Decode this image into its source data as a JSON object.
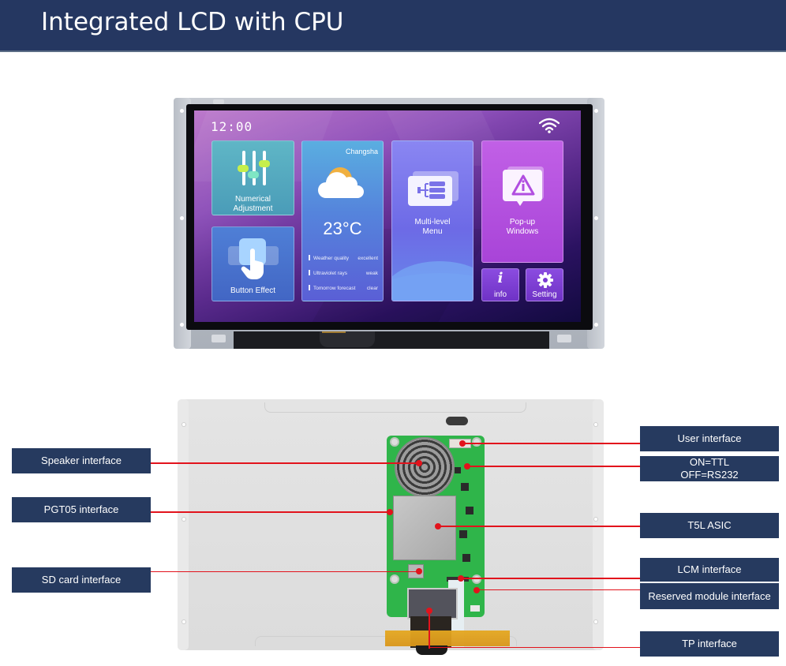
{
  "header": {
    "title": "Integrated LCD with CPU"
  },
  "screen": {
    "clock": "12:00",
    "status_icon": "wifi-icon",
    "tiles": {
      "numerical": {
        "label_line1": "Numerical",
        "label_line2": "Adjustment",
        "icon": "slider-adjust-icon"
      },
      "button_effect": {
        "label": "Button Effect",
        "icon": "hand-tap-icon"
      },
      "weather": {
        "city": "Changsha",
        "icon": "partly-cloudy-icon",
        "temperature": "23°C",
        "rows": [
          {
            "label": "Weather quality",
            "value": "excellent"
          },
          {
            "label": "Ultraviolet rays",
            "value": "weak"
          },
          {
            "label": "Tomorrow forecast",
            "value": "clear"
          }
        ]
      },
      "menu": {
        "label_line1": "Multi-level",
        "label_line2": "Menu",
        "icon": "tree-menu-icon"
      },
      "popup": {
        "label_line1": "Pop-up",
        "label_line2": "Windows",
        "icon": "warning-icon"
      },
      "info": {
        "glyph": "i",
        "label": "info",
        "icon": "info-icon"
      },
      "setting": {
        "label": "Setting",
        "icon": "gear-icon"
      }
    }
  },
  "callouts": {
    "left": [
      {
        "label": "Speaker interface"
      },
      {
        "label": "PGT05 interface"
      },
      {
        "label": "SD card interface"
      }
    ],
    "right": [
      {
        "label": "User interface"
      },
      {
        "label_line1": "ON=TTL",
        "label_line2": "OFF=RS232"
      },
      {
        "label": "T5L ASIC"
      },
      {
        "label": "LCM interface"
      },
      {
        "label": "Reserved module interface"
      },
      {
        "label": "TP interface"
      }
    ]
  },
  "colors": {
    "header_bg": "#253761",
    "callout_bg": "#263a5f",
    "leader_line": "#e2131c",
    "pcb": "#2fb54a"
  }
}
